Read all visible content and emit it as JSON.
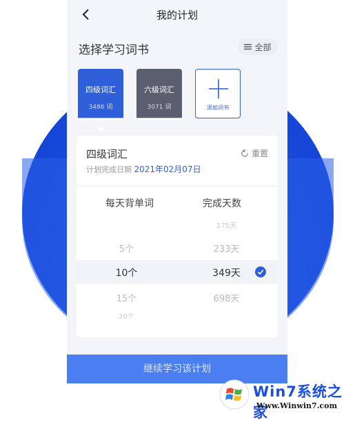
{
  "header": {
    "title": "我的计划"
  },
  "section": {
    "title": "选择学习词书",
    "all_label": "全部"
  },
  "books": [
    {
      "title": "四级词汇",
      "count": "3486 词",
      "color": "#2f5fd8"
    },
    {
      "title": "六级词汇",
      "count": "3071 词",
      "color": "#5a5e6e"
    }
  ],
  "add_book_label": "添加词书",
  "plan": {
    "book_title": "四级词汇",
    "reset_label": "重置",
    "date_label": "计划完成日期",
    "date_value": "2021年02月07日",
    "col_daily": "每天背单词",
    "col_days": "完成天数",
    "options": [
      {
        "daily": "",
        "days": "175天"
      },
      {
        "daily": "5个",
        "days": "233天"
      },
      {
        "daily": "10个",
        "days": "349天",
        "selected": true
      },
      {
        "daily": "15个",
        "days": "698天"
      },
      {
        "daily": "20个",
        "days": ""
      }
    ]
  },
  "cta_label": "继续学习该计划",
  "watermark": {
    "brand": "Win7系统之家",
    "url": "Www.Winwin7.com"
  },
  "colors": {
    "accent": "#2f5fd8",
    "bg_blob": "#1b4ee0",
    "cta": "#4b7ef0"
  }
}
